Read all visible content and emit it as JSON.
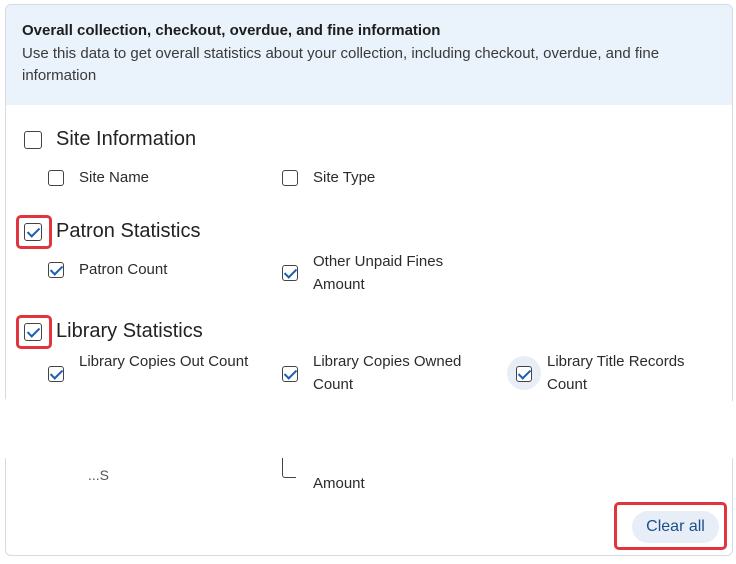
{
  "header": {
    "title": "Overall collection, checkout, overdue, and fine information",
    "description": "Use this data to get overall statistics about your collection, including checkout, overdue, and fine information"
  },
  "groups": {
    "site": {
      "label": "Site Information",
      "checked": false,
      "items": [
        {
          "label": "Site Name",
          "checked": false
        },
        {
          "label": "Site Type",
          "checked": false
        }
      ]
    },
    "patron": {
      "label": "Patron Statistics",
      "checked": true,
      "items": [
        {
          "label": "Patron Count",
          "checked": true
        },
        {
          "label": "Other Unpaid Fines Amount",
          "checked": true
        }
      ]
    },
    "library": {
      "label": "Library Statistics",
      "checked": true,
      "items": [
        {
          "label": "Library Copies Out Count",
          "checked": true
        },
        {
          "label": "Library Copies Owned Count",
          "checked": true
        },
        {
          "label": "Library Title Records Count",
          "checked": true
        }
      ]
    }
  },
  "partial_text": {
    "left": "...S",
    "middle": "Amount"
  },
  "footer": {
    "clear_all_label": "Clear all"
  },
  "colors": {
    "header_bg": "#eaf2fb",
    "highlight": "#e2343d",
    "check_accent": "#1a5fb4"
  }
}
